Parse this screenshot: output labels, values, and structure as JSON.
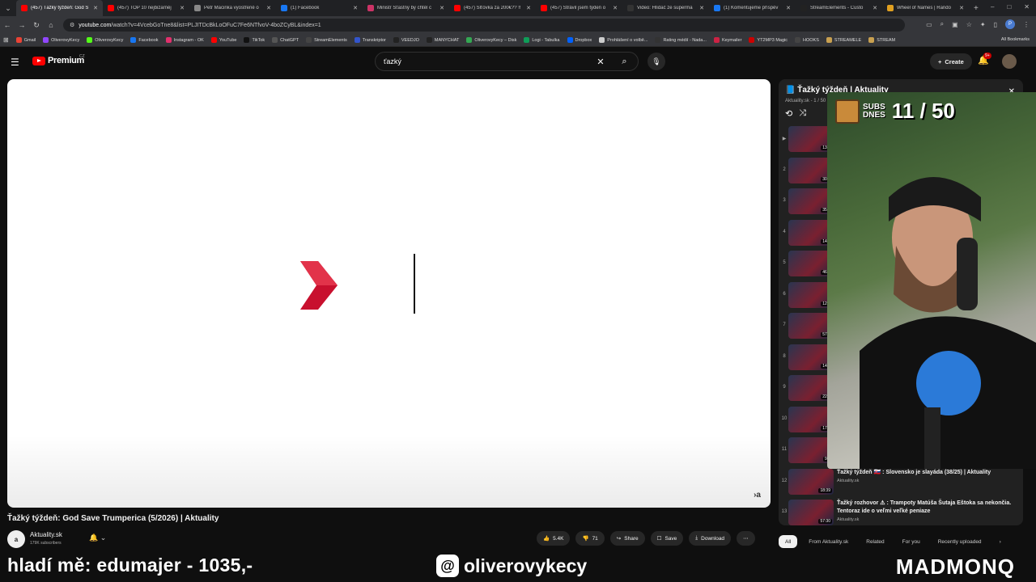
{
  "browser": {
    "tabs": [
      {
        "title": "(457) Ťažký týždeň: God S",
        "fav": "#ff0000",
        "active": true
      },
      {
        "title": "(457) TOP 10 nejbizarněj",
        "fav": "#ff0000"
      },
      {
        "title": "Petr Macinka vyostřeně o",
        "fav": "#888888"
      },
      {
        "title": "(1) Facebook",
        "fav": "#1877f2"
      },
      {
        "title": "Ministr Šťastný by chtěl c",
        "fav": "#cc3366"
      },
      {
        "title": "(457) Šlťovka za 200€?? ‼",
        "fav": "#ff0000"
      },
      {
        "title": "(457) Strávil jsem týden o",
        "fav": "#ff0000"
      },
      {
        "title": "Video: Hlídač ze superma",
        "fav": "#333333"
      },
      {
        "title": "(1) Komentujeme příspěv",
        "fav": "#1877f2"
      },
      {
        "title": "StreamElements - Custo",
        "fav": "#222222"
      },
      {
        "title": "Wheel of Names | Rando",
        "fav": "#e0a020"
      }
    ],
    "url_host": "youtube.com",
    "url_rest": "/watch?v=4VcebGoTne8&list=PLJITDcBkLoOFuC7Fe6NTfvoV-4boZCyBL&index=1",
    "bookmarks": [
      {
        "label": "Gmail",
        "color": "#ea4335"
      },
      {
        "label": "OliverovyKecy",
        "color": "#9147ff"
      },
      {
        "label": "OliverovyKecy",
        "color": "#53fc18"
      },
      {
        "label": "Facebook",
        "color": "#1877f2"
      },
      {
        "label": "Instagram - OK",
        "color": "#e1306c"
      },
      {
        "label": "YouTube",
        "color": "#ff0000"
      },
      {
        "label": "TikTok",
        "color": "#111111"
      },
      {
        "label": "ChatGPT",
        "color": "#555555"
      },
      {
        "label": "StreamElements",
        "color": "#444444"
      },
      {
        "label": "Transkriptor",
        "color": "#3355cc"
      },
      {
        "label": "VEEDJO",
        "color": "#222222"
      },
      {
        "label": "MANYCHAT",
        "color": "#222222"
      },
      {
        "label": "OliverovyKecy – Disk",
        "color": "#34a853"
      },
      {
        "label": "Logi - Tabulka",
        "color": "#0f9d58"
      },
      {
        "label": "Dropbox",
        "color": "#0061ff"
      },
      {
        "label": "Prohlášení o volbě...",
        "color": "#cccccc"
      },
      {
        "label": "Rating médií - Nada...",
        "color": "#333333"
      },
      {
        "label": "Keymailer",
        "color": "#cc2244"
      },
      {
        "label": "YT2MP3 Magic",
        "color": "#cc0000"
      },
      {
        "label": "HOOKS",
        "color": "#444444"
      },
      {
        "label": "STREAMELE",
        "color": "#c8a050"
      },
      {
        "label": "STREAM",
        "color": "#c8a050"
      }
    ],
    "all_bookmarks": "All Bookmarks"
  },
  "youtube": {
    "brand": "Premium",
    "region": "CZ",
    "search_query": "ťazký",
    "create_label": "Create",
    "notif_count": "9+",
    "video_title": "Ťažký týždeň: God Save Trumperica (5/2026) | Aktuality",
    "channel_name": "Aktuality.sk",
    "channel_subs": "179K subscribers",
    "channel_avatar_text": "a",
    "watermark": "›a",
    "actions": {
      "likes": "5.4K",
      "dislikes": "71",
      "share": "Share",
      "save": "Save",
      "download": "Download"
    }
  },
  "playlist": {
    "title": "Ťažký týždeň | Aktuality",
    "sub": "Aktuality.sk - 1 / 50",
    "items": [
      {
        "idx": "▶",
        "dur": "13:3",
        "title": "",
        "channel": ""
      },
      {
        "idx": "2",
        "dur": "30:0",
        "title": "",
        "channel": ""
      },
      {
        "idx": "3",
        "dur": "35:1",
        "title": "",
        "channel": ""
      },
      {
        "idx": "4",
        "dur": "14:2",
        "title": "",
        "channel": ""
      },
      {
        "idx": "5",
        "dur": "46:5",
        "title": "",
        "channel": ""
      },
      {
        "idx": "6",
        "dur": "12:0",
        "title": "",
        "channel": ""
      },
      {
        "idx": "7",
        "dur": "57:1",
        "title": "",
        "channel": ""
      },
      {
        "idx": "8",
        "dur": "14:3",
        "title": "",
        "channel": ""
      },
      {
        "idx": "9",
        "dur": "22:2",
        "title": "",
        "channel": ""
      },
      {
        "idx": "10",
        "dur": "17:2",
        "title": "",
        "channel": ""
      },
      {
        "idx": "11",
        "dur": "9:3",
        "title": "",
        "channel": ""
      },
      {
        "idx": "12",
        "dur": "18:39",
        "title": "Ťažký týždeň 🇸🇰 : Slovensko je slayáda (38/25) | Aktuality",
        "channel": "Aktuality.sk"
      },
      {
        "idx": "13",
        "dur": "57:30",
        "title": "Ťažký rozhovor ⚠ : Trampoty Matúša Šutaja Eštoka sa nekončia. Tentoraz ide o veľmi veľké peniaze",
        "channel": "Aktuality.sk"
      }
    ]
  },
  "chips": [
    "All",
    "From Aktuality.sk",
    "Related",
    "For you",
    "Recently uploaded"
  ],
  "stream_overlay": {
    "subs_label_1": "SUBS",
    "subs_label_2": "DNES",
    "subs_count": "11 / 50",
    "ticker": "hladí mě: edumajer - 1035,-",
    "threads_handle": "oliverovykecy",
    "brand": "MADMONQ"
  }
}
